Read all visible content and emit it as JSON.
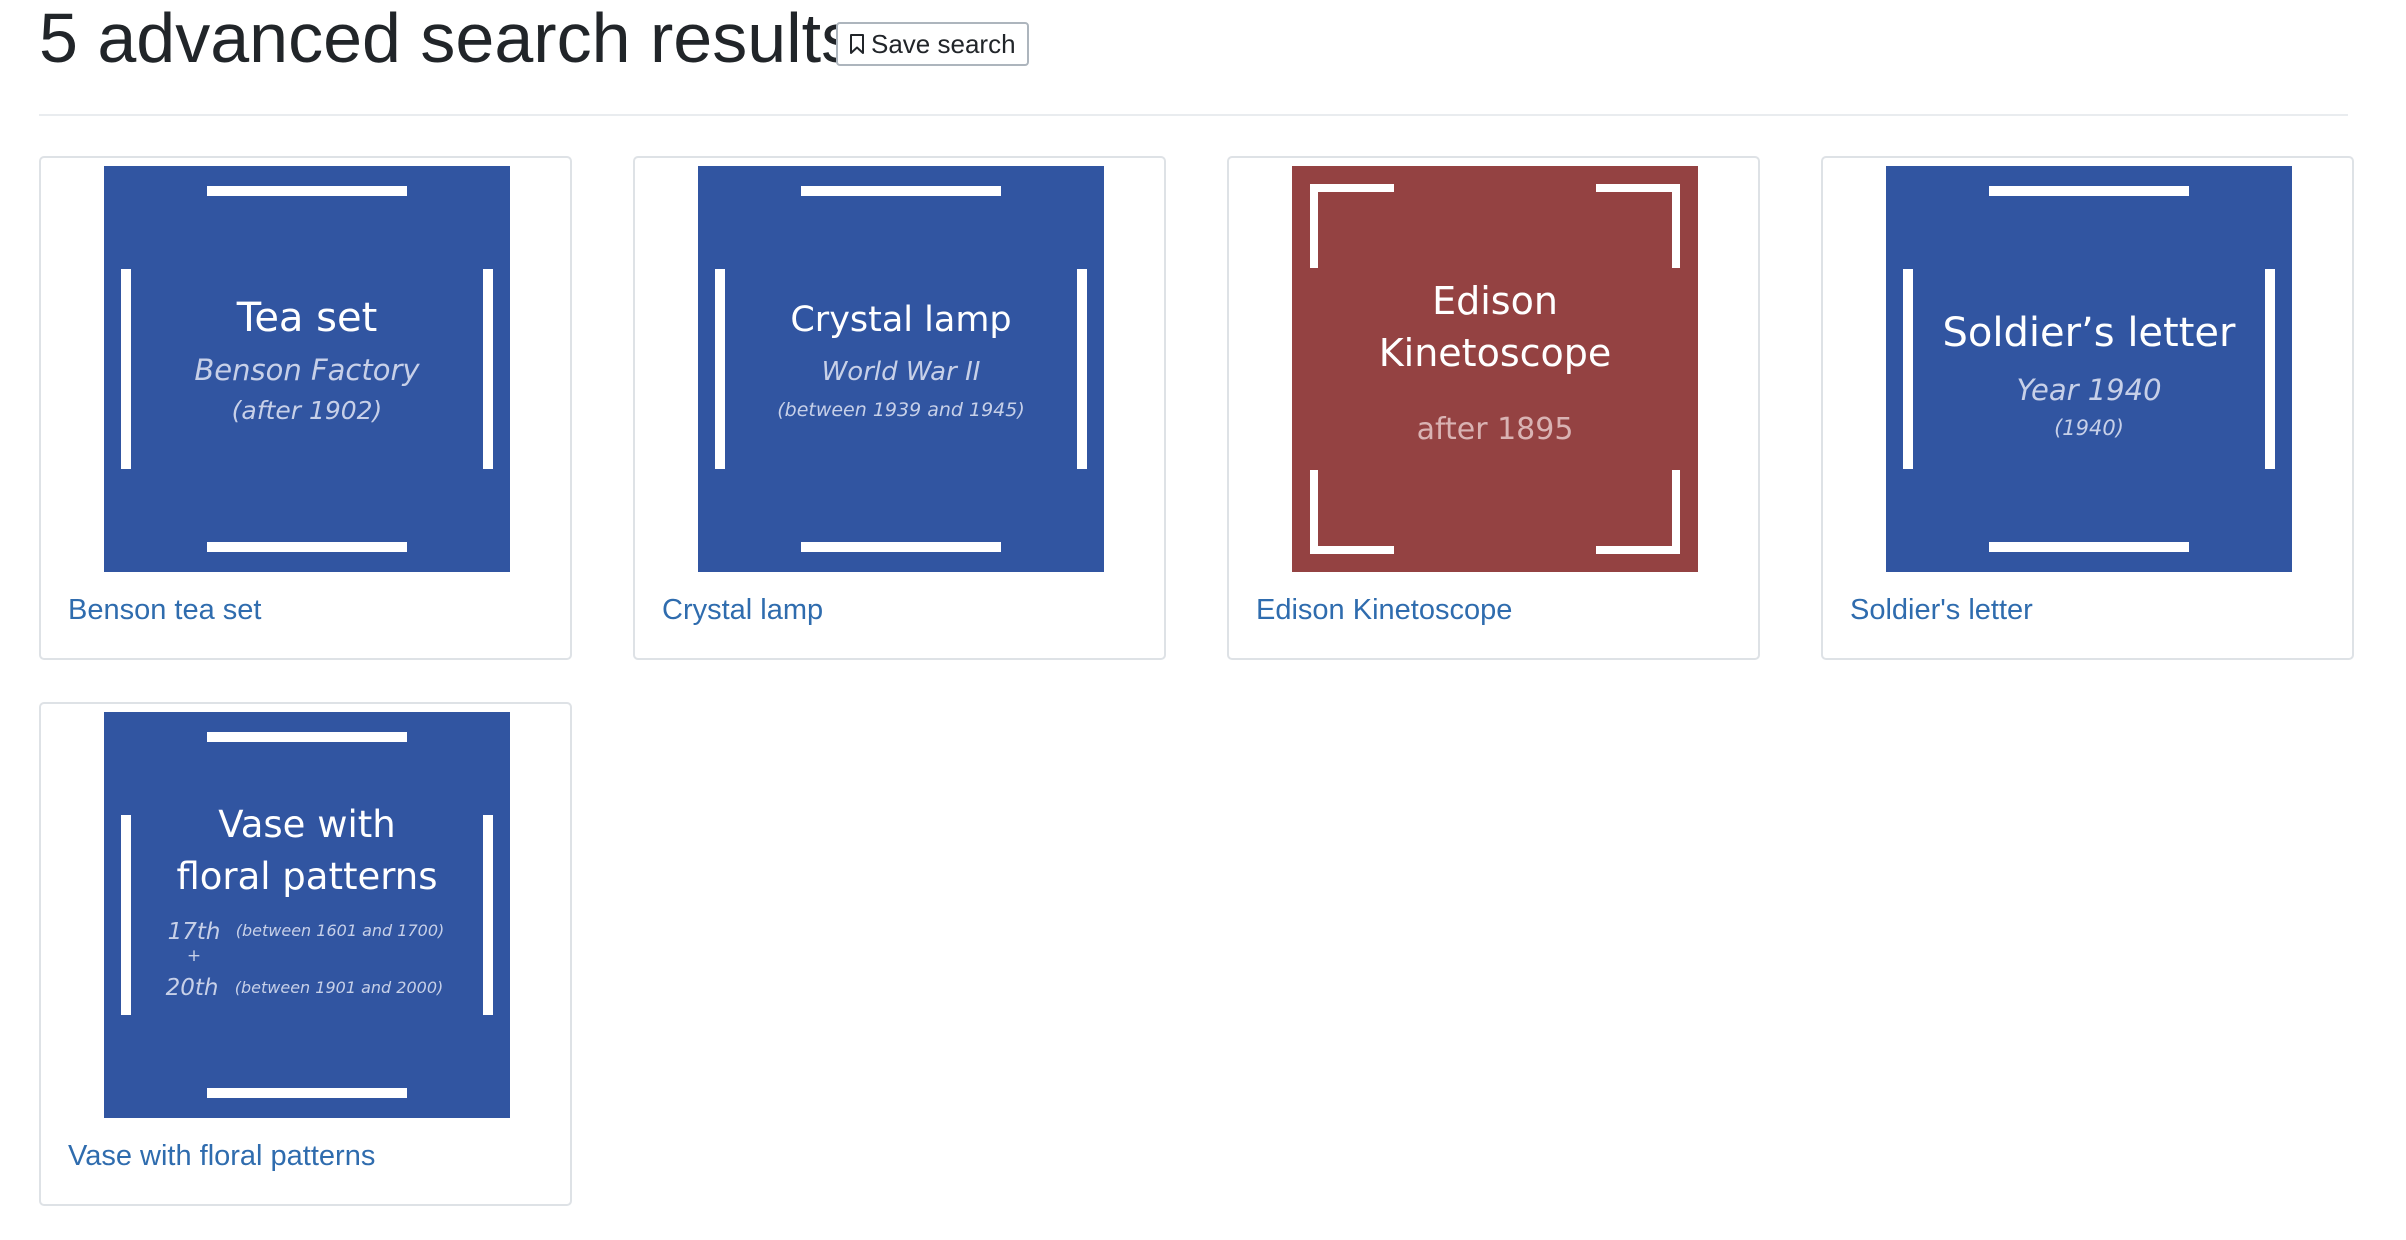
{
  "header": {
    "title": "5 advanced search results",
    "save_button": {
      "label": "Save search",
      "icon": "bookmark-icon"
    }
  },
  "colors": {
    "link": "#2f6cae",
    "thumb_blue": "#3155a1",
    "thumb_red": "#944242",
    "frame": "#ffffff"
  },
  "results": [
    {
      "title": "Benson tea set",
      "thumbnail": {
        "title": "Tea set",
        "subtitle": "Benson Factory",
        "date": "(after 1902)"
      }
    },
    {
      "title": "Crystal lamp",
      "thumbnail": {
        "title": "Crystal lamp",
        "subtitle": "World War II",
        "date": "(between 1939 and 1945)"
      }
    },
    {
      "title": "Edison Kinetoscope",
      "thumbnail": {
        "title_line1": "Edison",
        "title_line2": "Kinetoscope",
        "date": "after 1895"
      }
    },
    {
      "title": "Soldier's letter",
      "thumbnail": {
        "title": "Soldier’s letter",
        "subtitle": "Year 1940",
        "date": "(1940)"
      }
    },
    {
      "title": "Vase with floral patterns",
      "thumbnail": {
        "title_line1": "Vase with",
        "title_line2": "floral patterns",
        "century1": "17th",
        "range1": "(between 1601 and 1700)",
        "plus": "+",
        "century2": "20th",
        "range2": "(between 1901 and 2000)"
      }
    }
  ]
}
